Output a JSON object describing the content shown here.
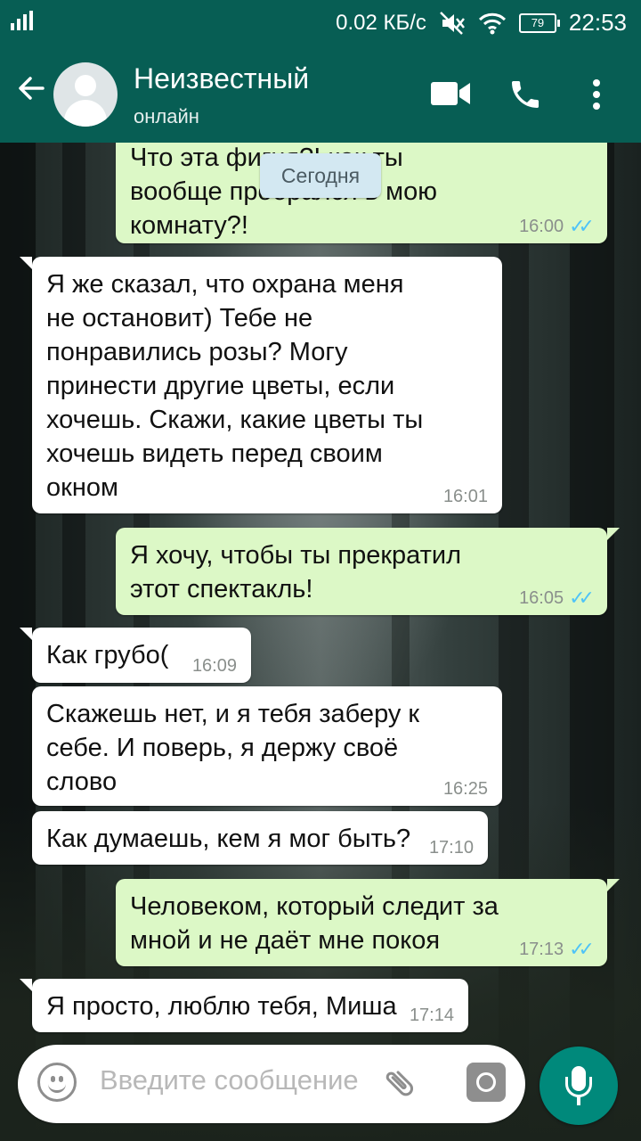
{
  "status_bar": {
    "net_speed": "0.02 КБ/с",
    "battery": "79",
    "time": "22:53"
  },
  "header": {
    "contact_name": "Неизвестный",
    "contact_status": "онлайн",
    "icons": [
      "back-arrow-icon",
      "avatar",
      "video-call-icon",
      "phone-icon",
      "more-vert-icon"
    ]
  },
  "date_chip": "Сегодня",
  "messages": [
    {
      "dir": "out",
      "text": "Что эта фигня?! как ты вообще пробрался в мою комнату?!",
      "time": "16:00",
      "read": true
    },
    {
      "dir": "in",
      "text": "Я же сказал, что охрана меня не остановит) Тебе не понравились розы? Могу принести другие цветы, если хочешь. Скажи, какие цветы ты хочешь видеть перед своим окном",
      "time": "16:01"
    },
    {
      "dir": "out",
      "text": "Я хочу, чтобы ты прекратил этот спектакль!",
      "time": "16:05",
      "read": true
    },
    {
      "dir": "in",
      "text": "Как грубо(",
      "time": "16:09"
    },
    {
      "dir": "in",
      "text": "Скажешь нет, и я тебя заберу к себе. И поверь, я держу своё слово",
      "time": "16:25"
    },
    {
      "dir": "in",
      "text": "Как думаешь, кем я мог быть?",
      "time": "17:10"
    },
    {
      "dir": "out",
      "text": "Человеком, который следит за мной и не даёт мне покоя",
      "time": "17:13",
      "read": true
    },
    {
      "dir": "in",
      "text": "Я просто, люблю тебя, Миша",
      "time": "17:14"
    }
  ],
  "input": {
    "placeholder": "Введите сообщение"
  },
  "colors": {
    "header": "#075e54",
    "outgoing_bubble": "#dcf8c6",
    "incoming_bubble": "#ffffff",
    "read_ticks": "#4fc3f7",
    "mic_button": "#00897b"
  }
}
